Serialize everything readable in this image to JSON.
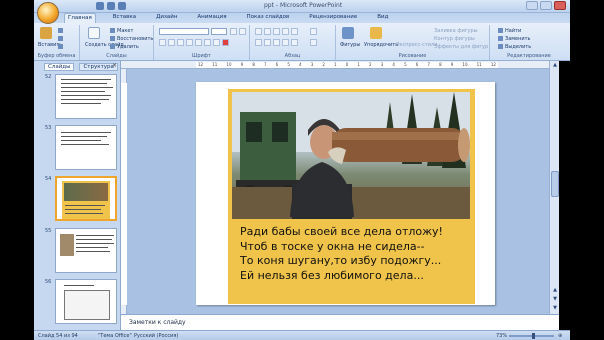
{
  "window": {
    "title": "ppt - Microsoft PowerPoint"
  },
  "ribbon": {
    "tabs": [
      "Главная",
      "Вставка",
      "Дизайн",
      "Анимация",
      "Показ слайдов",
      "Рецензирование",
      "Вид"
    ],
    "active_tab": "Главная",
    "clipboard": {
      "paste": "Вставить",
      "cut": "Вырезать",
      "copy": "Копировать",
      "label": "Буфер обмена"
    },
    "slides": {
      "create": "Создать слайд",
      "layout": "Макет",
      "reset": "Восстановить",
      "delete": "Удалить",
      "label": "Слайды"
    },
    "font": {
      "label": "Шрифт"
    },
    "paragraph": {
      "label": "Абзац"
    },
    "drawing": {
      "shapes": "Фигуры",
      "arrange": "Упорядочить",
      "quick_styles": "Экспресс-стили",
      "fill": "Заливка фигуры",
      "outline": "Контур фигуры",
      "effects": "Эффекты для фигур",
      "label": "Рисование"
    },
    "editing": {
      "find": "Найти",
      "replace": "Заменить",
      "select": "Выделить",
      "label": "Редактирование"
    }
  },
  "left_pane": {
    "tabs": [
      "Слайды",
      "Структура"
    ],
    "active_tab": "Слайды",
    "close": "×",
    "slide_numbers": [
      "52",
      "53",
      "54",
      "55",
      "56"
    ],
    "selected": "54"
  },
  "ruler": {
    "ticks": [
      "12",
      "11",
      "10",
      "9",
      "8",
      "7",
      "6",
      "5",
      "4",
      "3",
      "2",
      "1",
      "0",
      "1",
      "2",
      "3",
      "4",
      "5",
      "6",
      "7",
      "8",
      "9",
      "10",
      "11",
      "12"
    ]
  },
  "slide": {
    "poem": [
      "Ради бабы своей все дела отложу!",
      "Чтоб в тоске у окна не сидела--",
      "То коня шугану,то избу подожгу...",
      "Ей нельзя без любимого дела..."
    ]
  },
  "notes": {
    "placeholder": "Заметки к слайду"
  },
  "status": {
    "slide_info": "Слайд 54 из 94",
    "theme": "\"Тема Office\"",
    "language": "Русский (Россия)",
    "zoom": "73%"
  },
  "colors": {
    "accent": "#f0a52c",
    "ribbon": "#dbe8f7",
    "frame": "#f0c34a"
  }
}
